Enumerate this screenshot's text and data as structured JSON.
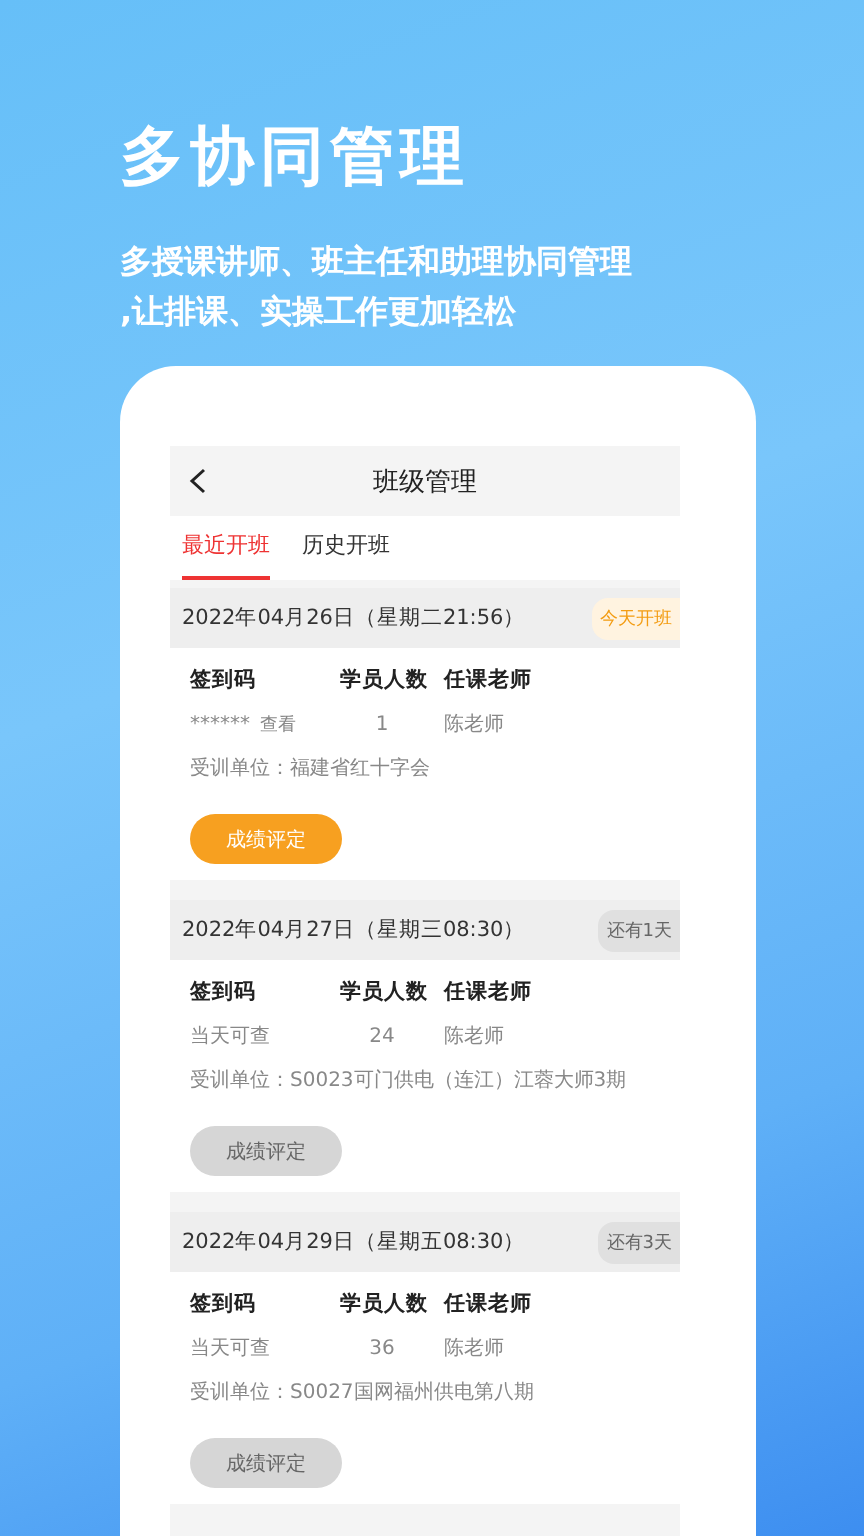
{
  "headline": "多协同管理",
  "subtitle": [
    "多授课讲师、班主任和助理协同管理",
    ",让排课、实操工作更加轻松"
  ],
  "app": {
    "title": "班级管理",
    "tabs": [
      {
        "label": "最近开班",
        "selected": true
      },
      {
        "label": "历史开班",
        "selected": false
      }
    ],
    "classes": [
      {
        "date": "2022年04月26日（星期二21:56）",
        "badge": {
          "label": "今天开班",
          "highlighted": true
        },
        "headers": [
          "签到码",
          "学员人数",
          "任课老师"
        ],
        "code": "******",
        "code_link": "查看",
        "count": "1",
        "teacher": "陈老师",
        "unit": "受训单位：福建省红十字会",
        "button": {
          "label": "成绩评定",
          "disabled": false
        }
      },
      {
        "date": "2022年04月27日（星期三08:30）",
        "badge": {
          "label": "还有1天",
          "highlighted": false
        },
        "headers": [
          "签到码",
          "学员人数",
          "任课老师"
        ],
        "code": "当天可查",
        "count": "24",
        "teacher": "陈老师",
        "unit": "受训单位：S0023可门供电（连江）江蓉大师3期",
        "button": {
          "label": "成绩评定",
          "disabled": true
        }
      },
      {
        "date": "2022年04月29日（星期五08:30）",
        "badge": {
          "label": "还有3天",
          "highlighted": false
        },
        "headers": [
          "签到码",
          "学员人数",
          "任课老师"
        ],
        "code": "当天可查",
        "count": "36",
        "teacher": "陈老师",
        "unit": "受训单位：S0027国网福州供电第八期",
        "button": {
          "label": "成绩评定",
          "disabled": true
        }
      }
    ]
  }
}
